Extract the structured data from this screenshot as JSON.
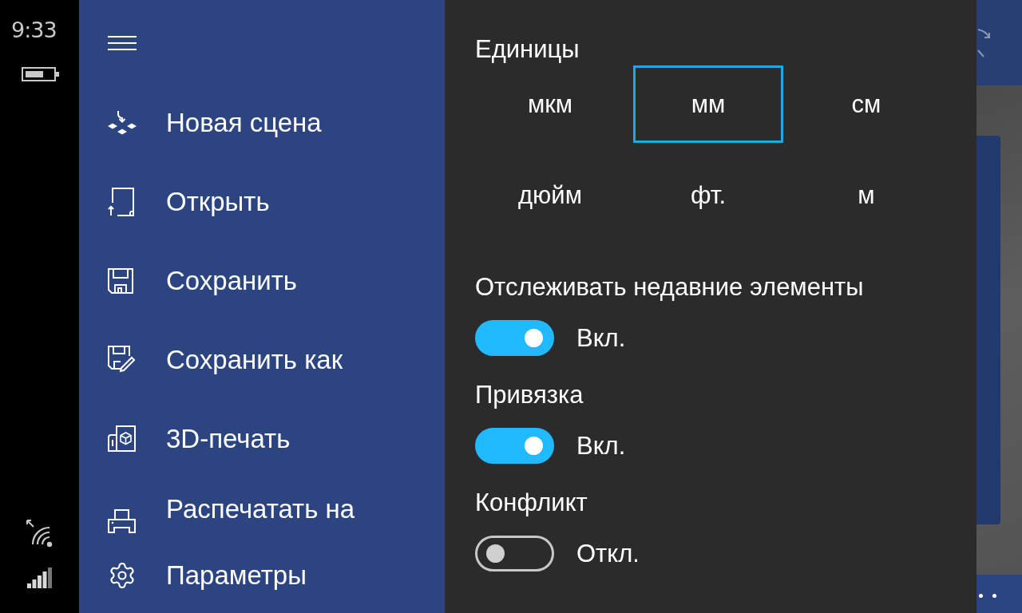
{
  "status_bar": {
    "time": "9:33"
  },
  "menu": {
    "items": [
      {
        "kind": "new",
        "label": "Новая сцена"
      },
      {
        "kind": "open",
        "label": "Открыть"
      },
      {
        "kind": "save",
        "label": "Сохранить"
      },
      {
        "kind": "saveas",
        "label": "Сохранить как"
      },
      {
        "kind": "print3d",
        "label": "3D-печать"
      },
      {
        "kind": "print",
        "label": "Распечатать на"
      }
    ],
    "footer": {
      "kind": "settings",
      "label": "Параметры"
    }
  },
  "settings": {
    "units": {
      "title": "Единицы",
      "options": [
        {
          "label": "мкм",
          "selected": false
        },
        {
          "label": "мм",
          "selected": true
        },
        {
          "label": "см",
          "selected": false
        },
        {
          "label": "дюйм",
          "selected": false
        },
        {
          "label": "фт.",
          "selected": false
        },
        {
          "label": "м",
          "selected": false
        }
      ]
    },
    "switches": [
      {
        "title": "Отслеживать недавние элементы",
        "on": true,
        "state_label": "Вкл."
      },
      {
        "title": "Привязка",
        "on": true,
        "state_label": "Вкл."
      },
      {
        "title": "Конфликт",
        "on": false,
        "state_label": "Откл."
      }
    ]
  }
}
